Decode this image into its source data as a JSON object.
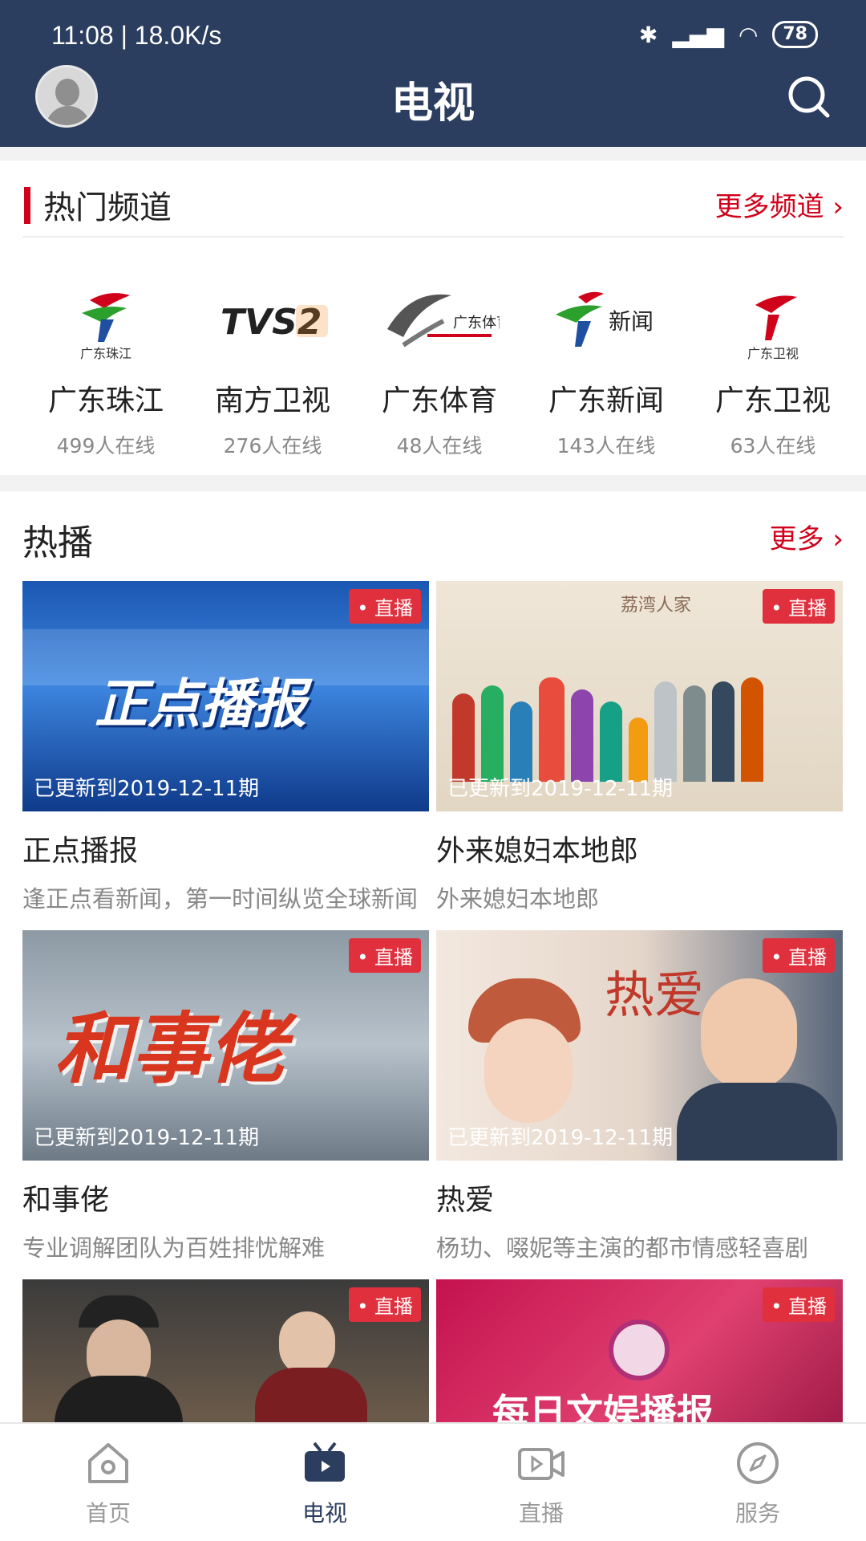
{
  "status": {
    "time": "11:08 | 18.0K/s",
    "battery": "78"
  },
  "header": {
    "title": "电视"
  },
  "channels": {
    "section_title": "热门频道",
    "more_label": "更多频道",
    "items": [
      {
        "name": "广东珠江",
        "online": "499人在线",
        "logo_text": "广东珠江"
      },
      {
        "name": "南方卫视",
        "online": "276人在线",
        "logo_text": "TVS2"
      },
      {
        "name": "广东体育",
        "online": "48人在线",
        "logo_text": "广东体育"
      },
      {
        "name": "广东新闻",
        "online": "143人在线",
        "logo_text": "新闻"
      },
      {
        "name": "广东卫视",
        "online": "63人在线",
        "logo_text": "广东卫视"
      }
    ]
  },
  "hot": {
    "title": "热播",
    "more_label": "更多",
    "cards": [
      {
        "title": "正点播报",
        "desc": "逢正点看新闻，第一时间纵览全球新闻",
        "badge": "直播",
        "update": "已更新到2019-12-11期",
        "art": "正点播报"
      },
      {
        "title": "外来媳妇本地郎",
        "desc": "外来媳妇本地郎",
        "badge": "直播",
        "update": "已更新到2019-12-11期",
        "art": "荔湾人家"
      },
      {
        "title": "和事佬",
        "desc": "专业调解团队为百姓排忧解难",
        "badge": "直播",
        "update": "已更新到2019-12-11期",
        "art": "和事佬"
      },
      {
        "title": "热爱",
        "desc": "杨玏、啜妮等主演的都市情感轻喜剧",
        "badge": "直播",
        "update": "已更新到2019-12-11期",
        "art": "热爱"
      },
      {
        "title": "",
        "desc": "",
        "badge": "直播",
        "update": "",
        "art": ""
      },
      {
        "title": "",
        "desc": "",
        "badge": "直播",
        "update": "",
        "art": "每日文娱播报"
      }
    ]
  },
  "nav": {
    "items": [
      {
        "label": "首页"
      },
      {
        "label": "电视"
      },
      {
        "label": "直播"
      },
      {
        "label": "服务"
      }
    ]
  },
  "colors": {
    "header_bg": "#2c3e5f",
    "accent_red": "#d0021b",
    "live_badge": "#e0303e"
  }
}
